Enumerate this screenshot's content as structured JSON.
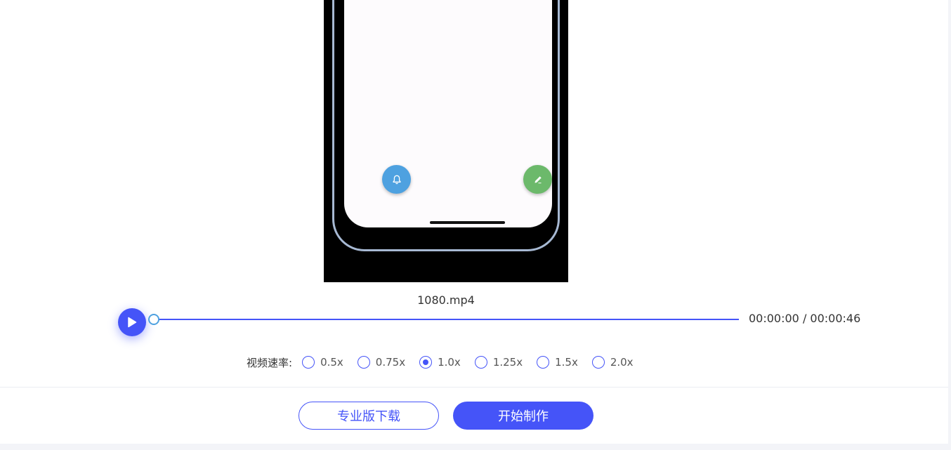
{
  "preview": {
    "file_name": "1080.mp4",
    "bell_icon": "bell-icon",
    "edit_icon": "pencil-icon"
  },
  "player": {
    "play_icon": "play-icon",
    "progress": 0,
    "current_time": "00:00:00",
    "total_time": "00:00:46",
    "time_display": "00:00:00 / 00:00:46"
  },
  "speed": {
    "label": "视频速率:",
    "options": [
      "0.5x",
      "0.75x",
      "1.0x",
      "1.25x",
      "1.5x",
      "2.0x"
    ],
    "selected": "1.0x"
  },
  "actions": {
    "download_pro_label": "专业版下载",
    "start_label": "开始制作"
  },
  "colors": {
    "accent": "#4554f8",
    "fab_bell": "#4ea1e0",
    "fab_edit": "#6cb96b"
  }
}
